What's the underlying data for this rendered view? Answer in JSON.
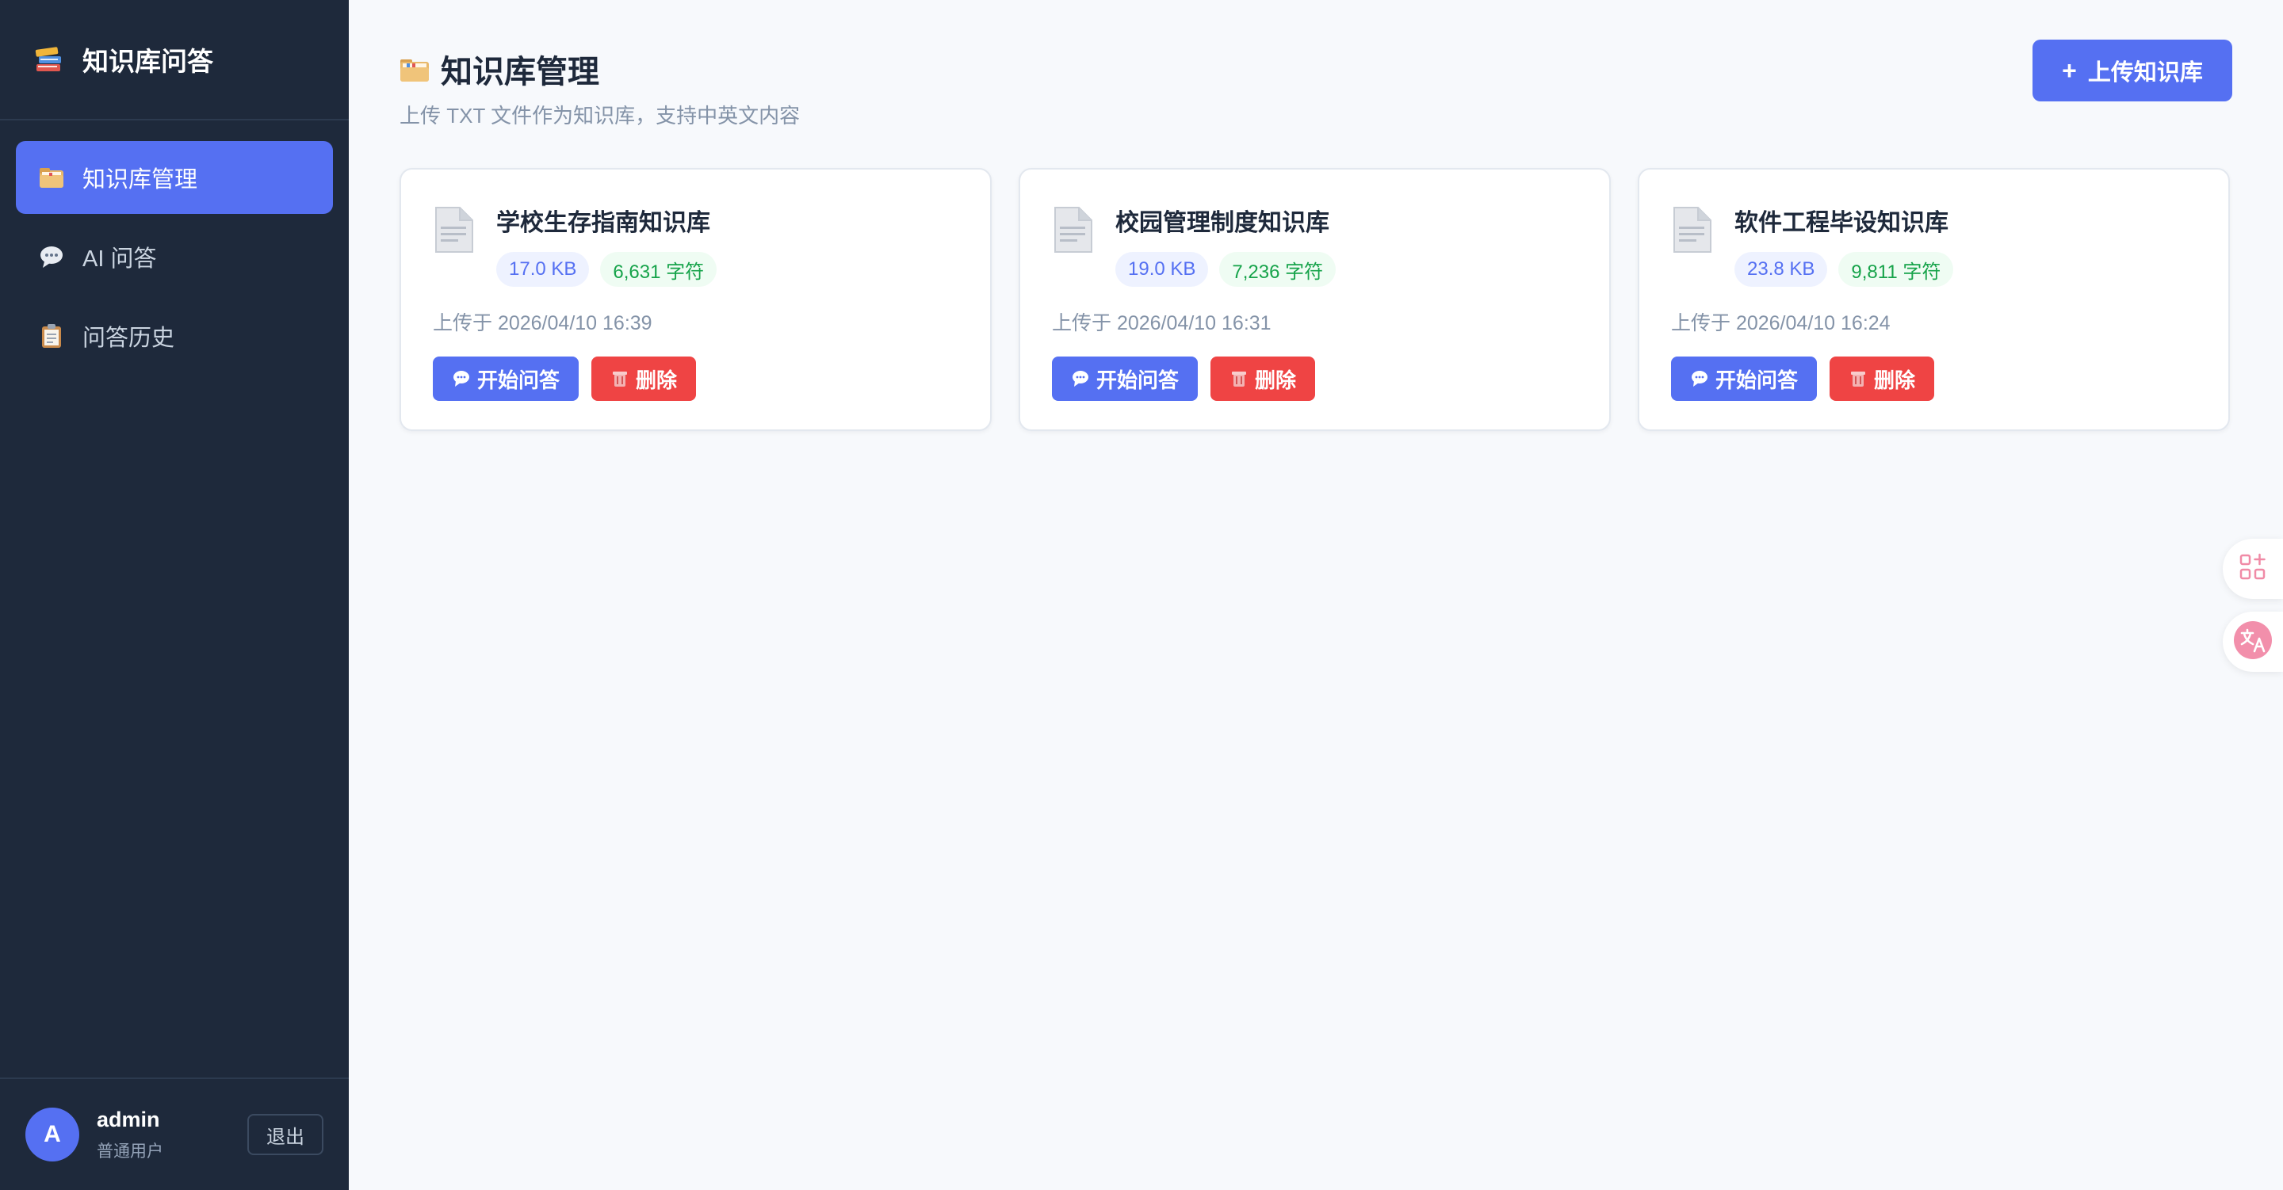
{
  "app": {
    "brand_title": "知识库问答"
  },
  "sidebar": {
    "items": [
      {
        "label": "知识库管理",
        "icon": "folder-icon",
        "active": true
      },
      {
        "label": "AI 问答",
        "icon": "speech-bubble-icon",
        "active": false
      },
      {
        "label": "问答历史",
        "icon": "clipboard-icon",
        "active": false
      }
    ],
    "user": {
      "avatar_letter": "A",
      "name": "admin",
      "role": "普通用户",
      "logout_label": "退出"
    }
  },
  "header": {
    "title": "知识库管理",
    "subtitle": "上传 TXT 文件作为知识库，支持中英文内容",
    "upload_label": "上传知识库",
    "upload_icon": "plus-icon"
  },
  "cards": [
    {
      "title": "学校生存指南知识库",
      "size": "17.0 KB",
      "chars": "6,631 字符",
      "uploaded": "上传于 2026/04/10 16:39",
      "ask_label": "开始问答",
      "delete_label": "删除"
    },
    {
      "title": "校园管理制度知识库",
      "size": "19.0 KB",
      "chars": "7,236 字符",
      "uploaded": "上传于 2026/04/10 16:31",
      "ask_label": "开始问答",
      "delete_label": "删除"
    },
    {
      "title": "软件工程毕设知识库",
      "size": "23.8 KB",
      "chars": "9,811 字符",
      "uploaded": "上传于 2026/04/10 16:24",
      "ask_label": "开始问答",
      "delete_label": "删除"
    }
  ],
  "colors": {
    "accent": "#5570f2",
    "danger": "#ef4444",
    "sidebar_bg": "#1e293b",
    "success": "#16a34a"
  }
}
